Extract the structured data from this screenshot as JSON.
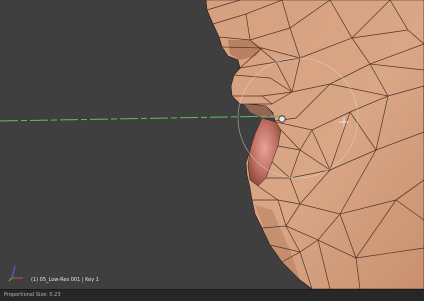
{
  "viewport": {
    "object_info": "(1) 05_Low-Res 001 | Key 1",
    "cursor_icon": "crosshair-icon",
    "brush_icon": "brush-circle-icon",
    "axis_icon": "axis-gizmo-icon"
  },
  "statusbar": {
    "text": "Proportional Size: 0.23"
  },
  "colors": {
    "background": "#3f3f3f",
    "skin": "#d9a382",
    "wire": "#3b2218",
    "guide_line": "#5fbf5f",
    "selected_vertex": "#e6e6e6"
  }
}
